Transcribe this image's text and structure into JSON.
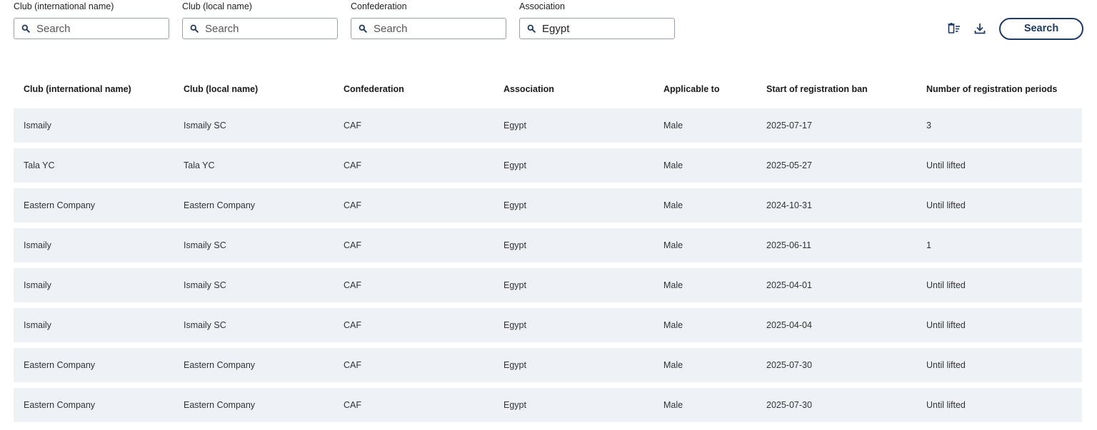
{
  "filters": [
    {
      "label": "Club (international name)",
      "value": "",
      "placeholder": "Search"
    },
    {
      "label": "Club (local name)",
      "value": "",
      "placeholder": "Search"
    },
    {
      "label": "Confederation",
      "value": "",
      "placeholder": "Search"
    },
    {
      "label": "Association",
      "value": "Egypt",
      "placeholder": "Search"
    }
  ],
  "toolbar": {
    "clear_filters_icon": "clear-filters-icon",
    "download_icon": "download-icon",
    "search_label": "Search"
  },
  "table": {
    "columns": [
      "Club (international name)",
      "Club (local name)",
      "Confederation",
      "Association",
      "Applicable to",
      "Start of registration ban",
      "Number of registration periods"
    ],
    "rows": [
      [
        "Ismaily",
        "Ismaily SC",
        "CAF",
        "Egypt",
        "Male",
        "2025-07-17",
        "3"
      ],
      [
        "Tala YC",
        "Tala YC",
        "CAF",
        "Egypt",
        "Male",
        "2025-05-27",
        "Until lifted"
      ],
      [
        "Eastern Company",
        "Eastern Company",
        "CAF",
        "Egypt",
        "Male",
        "2024-10-31",
        "Until lifted"
      ],
      [
        "Ismaily",
        "Ismaily SC",
        "CAF",
        "Egypt",
        "Male",
        "2025-06-11",
        "1"
      ],
      [
        "Ismaily",
        "Ismaily SC",
        "CAF",
        "Egypt",
        "Male",
        "2025-04-01",
        "Until lifted"
      ],
      [
        "Ismaily",
        "Ismaily SC",
        "CAF",
        "Egypt",
        "Male",
        "2025-04-04",
        "Until lifted"
      ],
      [
        "Eastern Company",
        "Eastern Company",
        "CAF",
        "Egypt",
        "Male",
        "2025-07-30",
        "Until lifted"
      ],
      [
        "Eastern Company",
        "Eastern Company",
        "CAF",
        "Egypt",
        "Male",
        "2025-07-30",
        "Until lifted"
      ]
    ]
  },
  "colors": {
    "accent": "#1d3b66",
    "row_background": "#eef1f6",
    "input_border": "#9aa1a9"
  }
}
